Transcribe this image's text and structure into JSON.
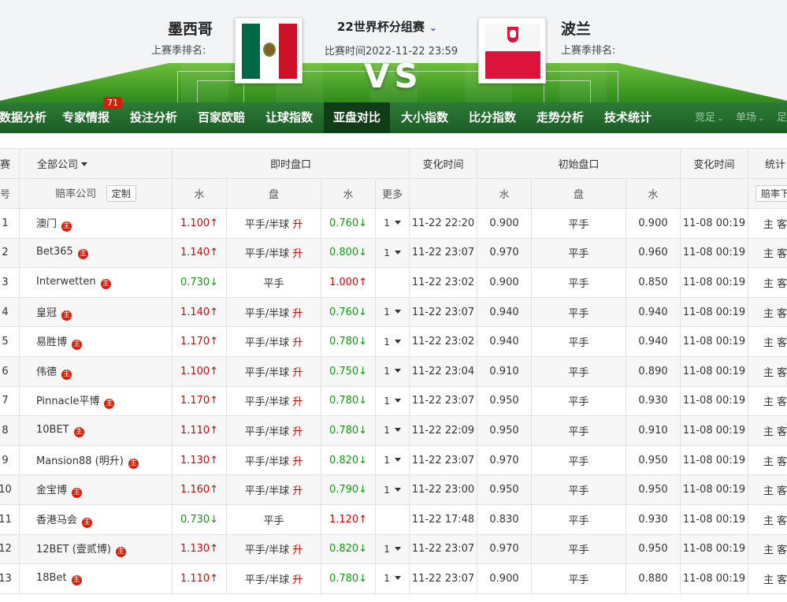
{
  "match": {
    "home_team": "墨西哥",
    "away_team": "波兰",
    "home_rank_label": "上赛季排名:",
    "away_rank_label": "上赛季排名:",
    "competition": "22世界杯分组赛",
    "time": "比赛时间2022-11-22 23:59",
    "vs": "VS"
  },
  "nav": {
    "items": [
      "数据分析",
      "专家情报",
      "投注分析",
      "百家欧赔",
      "让球指数",
      "亚盘对比",
      "大小指数",
      "比分指数",
      "走势分析",
      "技术统计"
    ],
    "active": "亚盘对比",
    "badge": "71",
    "right": [
      "竞足",
      "单场",
      "足"
    ]
  },
  "table": {
    "header1": {
      "col0": "赛",
      "company_filter": "全部公司",
      "live": "即时盘口",
      "change_time": "变化时间",
      "initial": "初始盘口",
      "change_time2": "变化时间",
      "stats": "统计"
    },
    "header2": {
      "col0": "号",
      "company": "赔率公司",
      "customize": "定制",
      "water": "水",
      "handicap": "盘",
      "water2": "水",
      "more": "更多",
      "water3": "水",
      "handicap2": "盘",
      "water4": "水",
      "stats_btn": "赔率下"
    },
    "icon_char": "主",
    "rise_label": "升",
    "rows": [
      {
        "no": "1",
        "company": "澳门",
        "w1": "1.100↑",
        "w1_dir": "up",
        "hcp": "平手/半球",
        "rise": true,
        "w2": "0.760↓",
        "w2_dir": "down",
        "more": "1",
        "time": "11-22 22:20",
        "iw1": "0.900",
        "ihcp": "平手",
        "iw2": "0.900",
        "itime": "11-08 00:19",
        "stat": "主 客"
      },
      {
        "no": "2",
        "company": "Bet365",
        "w1": "1.140↑",
        "w1_dir": "up",
        "hcp": "平手/半球",
        "rise": true,
        "w2": "0.800↓",
        "w2_dir": "down",
        "more": "1",
        "time": "11-22 23:07",
        "iw1": "0.970",
        "ihcp": "平手",
        "iw2": "0.960",
        "itime": "11-08 00:19",
        "stat": "主 客"
      },
      {
        "no": "3",
        "company": "Interwetten",
        "w1": "0.730↓",
        "w1_dir": "down",
        "hcp": "平手",
        "rise": false,
        "w2": "1.000↑",
        "w2_dir": "up",
        "more": "",
        "time": "11-22 23:02",
        "iw1": "0.900",
        "ihcp": "平手",
        "iw2": "0.850",
        "itime": "11-08 00:19",
        "stat": "主 客"
      },
      {
        "no": "4",
        "company": "皇冠",
        "w1": "1.140↑",
        "w1_dir": "up",
        "hcp": "平手/半球",
        "rise": true,
        "w2": "0.760↓",
        "w2_dir": "down",
        "more": "1",
        "time": "11-22 23:07",
        "iw1": "0.940",
        "ihcp": "平手",
        "iw2": "0.940",
        "itime": "11-08 00:19",
        "stat": "主 客"
      },
      {
        "no": "5",
        "company": "易胜博",
        "w1": "1.170↑",
        "w1_dir": "up",
        "hcp": "平手/半球",
        "rise": true,
        "w2": "0.780↓",
        "w2_dir": "down",
        "more": "1",
        "time": "11-22 23:02",
        "iw1": "0.940",
        "ihcp": "平手",
        "iw2": "0.940",
        "itime": "11-08 00:19",
        "stat": "主 客"
      },
      {
        "no": "6",
        "company": "伟德",
        "w1": "1.100↑",
        "w1_dir": "up",
        "hcp": "平手/半球",
        "rise": true,
        "w2": "0.750↓",
        "w2_dir": "down",
        "more": "1",
        "time": "11-22 23:04",
        "iw1": "0.910",
        "ihcp": "平手",
        "iw2": "0.890",
        "itime": "11-08 00:19",
        "stat": "主 客"
      },
      {
        "no": "7",
        "company": "Pinnacle平博",
        "w1": "1.170↑",
        "w1_dir": "up",
        "hcp": "平手/半球",
        "rise": true,
        "w2": "0.780↓",
        "w2_dir": "down",
        "more": "1",
        "time": "11-22 23:07",
        "iw1": "0.950",
        "ihcp": "平手",
        "iw2": "0.930",
        "itime": "11-08 00:19",
        "stat": "主 客"
      },
      {
        "no": "8",
        "company": "10BET",
        "w1": "1.110↑",
        "w1_dir": "up",
        "hcp": "平手/半球",
        "rise": true,
        "w2": "0.780↓",
        "w2_dir": "down",
        "more": "1",
        "time": "11-22 22:09",
        "iw1": "0.950",
        "ihcp": "平手",
        "iw2": "0.910",
        "itime": "11-08 00:19",
        "stat": "主 客"
      },
      {
        "no": "9",
        "company": "Mansion88 (明升)",
        "w1": "1.130↑",
        "w1_dir": "up",
        "hcp": "平手/半球",
        "rise": true,
        "w2": "0.820↓",
        "w2_dir": "down",
        "more": "1",
        "time": "11-22 23:07",
        "iw1": "0.970",
        "ihcp": "平手",
        "iw2": "0.950",
        "itime": "11-08 00:19",
        "stat": "主 客"
      },
      {
        "no": "10",
        "company": "金宝博",
        "w1": "1.160↑",
        "w1_dir": "up",
        "hcp": "平手/半球",
        "rise": true,
        "w2": "0.790↓",
        "w2_dir": "down",
        "more": "1",
        "time": "11-22 23:00",
        "iw1": "0.950",
        "ihcp": "平手",
        "iw2": "0.950",
        "itime": "11-08 00:19",
        "stat": "主 客"
      },
      {
        "no": "11",
        "company": "香港马会",
        "w1": "0.730↓",
        "w1_dir": "down",
        "hcp": "平手",
        "rise": false,
        "w2": "1.120↑",
        "w2_dir": "up",
        "more": "",
        "time": "11-22 17:48",
        "iw1": "0.830",
        "ihcp": "平手",
        "iw2": "0.930",
        "itime": "11-08 00:19",
        "stat": "主 客"
      },
      {
        "no": "12",
        "company": "12BET (壹贰博)",
        "w1": "1.130↑",
        "w1_dir": "up",
        "hcp": "平手/半球",
        "rise": true,
        "w2": "0.820↓",
        "w2_dir": "down",
        "more": "1",
        "time": "11-22 23:07",
        "iw1": "0.970",
        "ihcp": "平手",
        "iw2": "0.950",
        "itime": "11-08 00:19",
        "stat": "主 客"
      },
      {
        "no": "13",
        "company": "18Bet",
        "w1": "1.110↑",
        "w1_dir": "up",
        "hcp": "平手/半球",
        "rise": true,
        "w2": "0.780↓",
        "w2_dir": "down",
        "more": "1",
        "time": "11-22 23:07",
        "iw1": "0.900",
        "ihcp": "平手",
        "iw2": "0.880",
        "itime": "11-08 00:19",
        "stat": "主 客"
      }
    ]
  },
  "colors": {
    "nav_green": "#1b5e26",
    "active_tab": "#0f3d18",
    "up_red": "#e00000",
    "down_green": "#119911",
    "badge_red": "#d81e06"
  }
}
